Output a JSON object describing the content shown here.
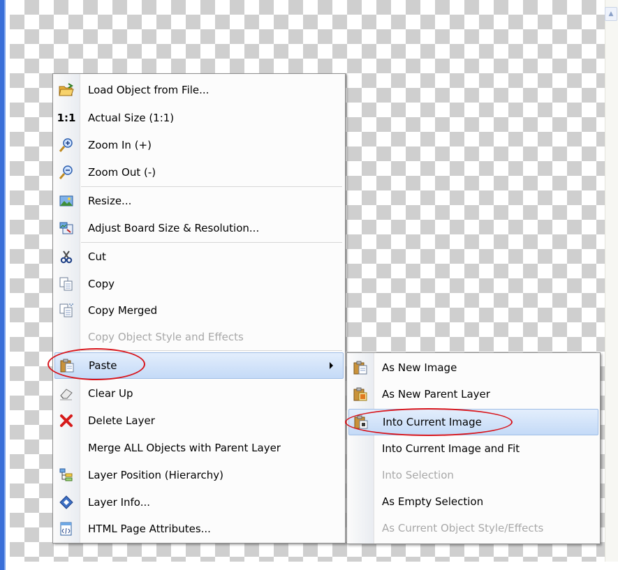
{
  "main_menu": {
    "items": [
      {
        "label": "Load Object from File...",
        "icon": "folder-open-icon",
        "disabled": false
      },
      {
        "label": "Actual Size (1:1)",
        "icon": "actual-size-icon",
        "disabled": false
      },
      {
        "label": "Zoom In (+)",
        "icon": "zoom-in-icon",
        "disabled": false
      },
      {
        "label": "Zoom Out (-)",
        "icon": "zoom-out-icon",
        "disabled": false
      },
      {
        "label": "Resize...",
        "icon": "resize-image-icon",
        "disabled": false
      },
      {
        "label": "Adjust Board Size & Resolution...",
        "icon": "board-size-icon",
        "disabled": false
      },
      {
        "label": "Cut",
        "icon": "scissors-icon",
        "disabled": false
      },
      {
        "label": "Copy",
        "icon": "copy-icon",
        "disabled": false
      },
      {
        "label": "Copy Merged",
        "icon": "copy-merged-icon",
        "disabled": false
      },
      {
        "label": "Copy Object Style and Effects",
        "icon": "",
        "disabled": true
      },
      {
        "label": "Paste",
        "icon": "clipboard-paste-icon",
        "disabled": false
      },
      {
        "label": "Clear Up",
        "icon": "eraser-icon",
        "disabled": false
      },
      {
        "label": "Delete Layer",
        "icon": "red-x-icon",
        "disabled": false
      },
      {
        "label": "Merge ALL Objects with Parent Layer",
        "icon": "",
        "disabled": false
      },
      {
        "label": "Layer Position (Hierarchy)",
        "icon": "hierarchy-icon",
        "disabled": false
      },
      {
        "label": "Layer Info...",
        "icon": "info-diamond-icon",
        "disabled": false
      },
      {
        "label": "HTML Page Attributes...",
        "icon": "html-page-icon",
        "disabled": false
      }
    ],
    "actual_size_glyph": "1:1"
  },
  "paste_submenu": {
    "items": [
      {
        "label": "As New Image",
        "icon": "clipboard-paste-icon",
        "disabled": false
      },
      {
        "label": "As New Parent Layer",
        "icon": "clipboard-layer-icon",
        "disabled": false
      },
      {
        "label": "Into Current Image",
        "icon": "clipboard-into-image-icon",
        "disabled": false
      },
      {
        "label": "Into Current Image and Fit",
        "icon": "",
        "disabled": false
      },
      {
        "label": "Into Selection",
        "icon": "",
        "disabled": true
      },
      {
        "label": "As Empty Selection",
        "icon": "",
        "disabled": false
      },
      {
        "label": "As Current Object Style/Effects",
        "icon": "",
        "disabled": true
      }
    ]
  },
  "colors": {
    "highlight_mark": "#d8141b",
    "menu_highlight": "#c4daf7",
    "window_frame": "#3a6fd8"
  }
}
